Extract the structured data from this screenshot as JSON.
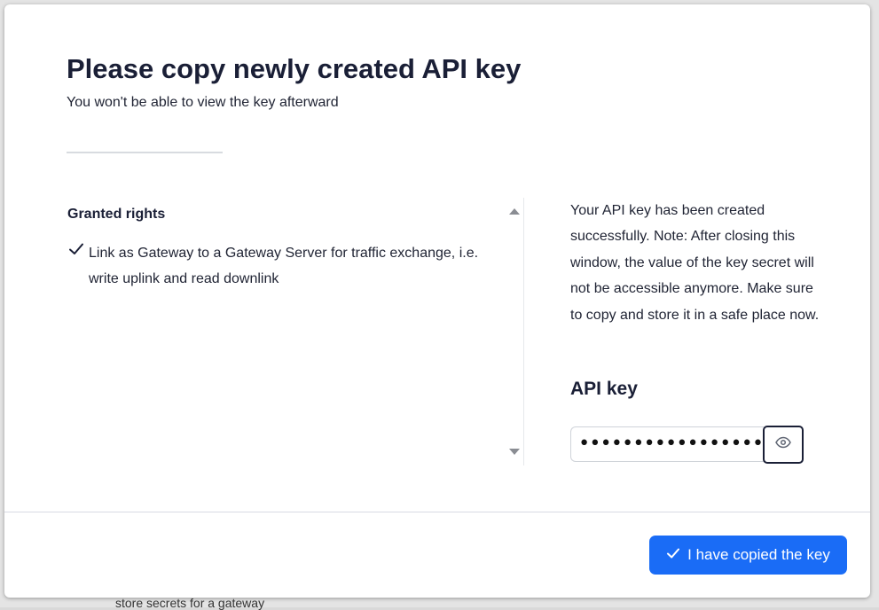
{
  "backdrop": {
    "partial_text": "store secrets for a gateway"
  },
  "modal": {
    "title": "Please copy newly created API key",
    "subtitle": "You won't be able to view the key afterward"
  },
  "rights": {
    "heading": "Granted rights",
    "items": [
      {
        "icon": "check-icon",
        "label": "Link as Gateway to a Gateway Server for traffic exchange, i.e. write uplink and read downlink"
      }
    ]
  },
  "info": {
    "message": "Your API key has been created successfully. Note: After closing this window, the value of the key secret will not be accessible anymore. Make sure to copy and store it in a safe place now."
  },
  "api_key": {
    "label": "API key",
    "masked_value": "••••••••••••••••••••",
    "toggle_icon": "eye-icon"
  },
  "footer": {
    "confirm_label": "I have copied the key",
    "confirm_icon": "check-icon"
  },
  "colors": {
    "accent": "#1a6cf6",
    "text": "#1a1f36"
  }
}
